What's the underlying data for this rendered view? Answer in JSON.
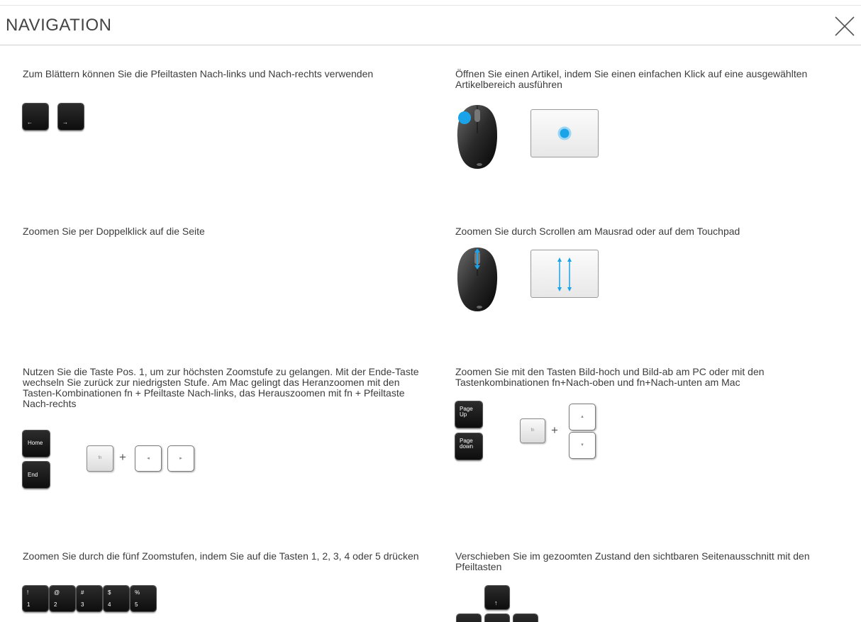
{
  "header": {
    "title": "NAVIGATION"
  },
  "sections": {
    "browse": {
      "text": "Zum Blättern können Sie die Pfeiltasten Nach-links und Nach-rechts verwenden",
      "keys": [
        "←",
        "→"
      ]
    },
    "open_article": {
      "text": "Öffnen Sie einen Artikel, indem Sie einen einfachen Klick auf eine ausgewählten Artikelbereich ausführen"
    },
    "zoom_doubleclick": {
      "text": "Zoomen Sie per Doppelklick auf die Seite"
    },
    "zoom_scroll": {
      "text": "Zoomen Sie durch Scrollen am Mausrad oder auf dem Touchpad"
    },
    "home_end": {
      "text": "Nutzen Sie die Taste Pos. 1, um zur höchsten Zoomstufe zu gelangen. Mit der Ende-Taste wechseln Sie zurück zur niedrigsten Stufe. Am Mac gelingt das Heranzoomen mit den Tasten-Kombinationen fn + Pfeiltaste Nach-links, das Herauszoomen mit fn + Pfeiltaste Nach-rechts",
      "home_label": "Home",
      "end_label": "End",
      "fn_label": "fn",
      "plus": "+",
      "left_arrow": "◂",
      "right_arrow": "▸"
    },
    "page_keys": {
      "text": "Zoomen Sie mit den Tasten Bild-hoch und Bild-ab am PC oder mit den Tastenkombinationen fn+Nach-oben und fn+Nach-unten am Mac",
      "page_up_line1": "Page",
      "page_up_line2": "Up",
      "page_down_line1": "Page",
      "page_down_line2": "down",
      "fn_label": "fn",
      "plus": "+",
      "up_arrow": "▴",
      "down_arrow": "▾"
    },
    "zoom_levels": {
      "text": "Zoomen Sie durch die fünf Zoomstufen, indem Sie auf die Tasten 1, 2, 3, 4 oder 5 drücken",
      "keys": [
        {
          "top": "!",
          "bottom": "1"
        },
        {
          "top": "@",
          "bottom": "2"
        },
        {
          "top": "#",
          "bottom": "3"
        },
        {
          "top": "$",
          "bottom": "4"
        },
        {
          "top": "%",
          "bottom": "5"
        }
      ]
    },
    "pan": {
      "text": "Verschieben Sie im gezoomten Zustand den sichtbaren Seitenausschnitt mit den Pfeiltasten",
      "up_arrow": "↑"
    }
  },
  "colors": {
    "accent": "#1aa3e8",
    "key_dark": "#111111"
  }
}
